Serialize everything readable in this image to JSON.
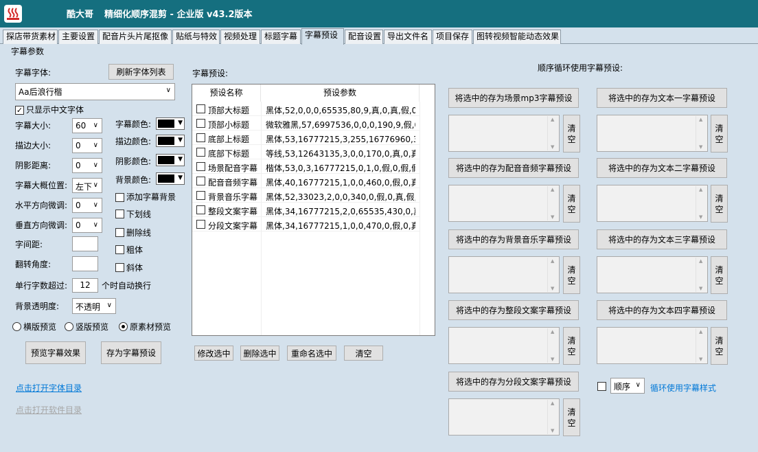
{
  "title": {
    "author": "酷大哥",
    "app": "精细化顺序混剪 - 企业版 v43.2版本"
  },
  "tabs": [
    "探店带货素材",
    "主要设置",
    "配音片头片尾抠像",
    "贴纸与特效",
    "视频处理",
    "标题字幕",
    "字幕预设",
    "配音设置",
    "导出文件名",
    "项目保存",
    "图转视频智能动态效果"
  ],
  "active_tab": "字幕预设",
  "params": {
    "section_title": "字幕参数",
    "font_label": "字幕字体:",
    "refresh_button": "刷新字体列表",
    "font_value": "Aa后浪行楷",
    "chinese_only_label": "只显示中文字体",
    "size_label": "字幕大小:",
    "size_value": "60",
    "stroke_label": "描边大小:",
    "stroke_value": "0",
    "shadow_label": "阴影距离:",
    "shadow_value": "0",
    "position_label": "字幕大概位置:",
    "position_value": "左下",
    "h_adjust_label": "水平方向微调:",
    "h_adjust_value": "0",
    "v_adjust_label": "垂直方向微调:",
    "v_adjust_value": "0",
    "spacing_label": "字间距:",
    "spacing_value": "",
    "rotate_label": "翻转角度:",
    "rotate_value": "",
    "wrap_prefix": "单行字数超过:",
    "wrap_value": "12",
    "wrap_suffix": "个时自动换行",
    "opacity_label": "背景透明度:",
    "opacity_value": "不透明",
    "font_color_label": "字幕颜色:",
    "stroke_color_label": "描边颜色:",
    "shadow_color_label": "阴影颜色:",
    "bg_color_label": "背景颜色:",
    "add_bg_label": "添加字幕背景",
    "underline_label": "下划线",
    "strikeout_label": "删除线",
    "bold_label": "粗体",
    "italic_label": "斜体",
    "preview_modes": [
      "横版预览",
      "竖版预览",
      "原素材预览"
    ],
    "preview_selected": 2,
    "preview_button": "预览字幕效果",
    "save_preset_button": "存为字幕预设",
    "open_font_dir": "点击打开字体目录",
    "open_app_dir": "点击打开软件目录"
  },
  "presets": {
    "label": "字幕预设:",
    "columns": [
      "预设名称",
      "预设参数"
    ],
    "rows": [
      {
        "name": "顶部大标题",
        "params": "黑体,52,0,0,0,65535,80,9,真,0,真,假,0,..."
      },
      {
        "name": "顶部小标题",
        "params": "微软雅黑,57,6997536,0,0,0,190,9,假,0,..."
      },
      {
        "name": "底部上标题",
        "params": "黑体,53,16777215,3,255,16776960,31..."
      },
      {
        "name": "底部下标题",
        "params": "等线,53,12643135,3,0,0,170,0,真,0,真,..."
      },
      {
        "name": "场景配音字幕",
        "params": "楷体,53,0,3,16777215,0,1,0,假,0,假,假,..."
      },
      {
        "name": "配音音频字幕",
        "params": "黑体,40,16777215,1,0,0,460,0,假,0,真,..."
      },
      {
        "name": "背景音乐字幕",
        "params": "黑体,52,33023,2,0,0,340,0,假,0,真,假,0..."
      },
      {
        "name": "整段文案字幕",
        "params": "黑体,34,16777215,2,0,65535,430,0,真,..."
      },
      {
        "name": "分段文案字幕",
        "params": "黑体,34,16777215,1,0,0,470,0,假,0,真,..."
      }
    ],
    "buttons": {
      "modify": "修改选中",
      "delete": "删除选中",
      "rename": "重命名选中",
      "clear": "清空"
    }
  },
  "cycle": {
    "title": "顺序循环使用字幕预设:",
    "left_buttons": [
      "将选中的存为场景mp3字幕预设",
      "将选中的存为配音音频字幕预设",
      "将选中的存为背景音乐字幕预设",
      "将选中的存为整段文案字幕预设",
      "将选中的存为分段文案字幕预设"
    ],
    "right_buttons": [
      "将选中的存为文本一字幕预设",
      "将选中的存为文本二字幕预设",
      "将选中的存为文本三字幕预设",
      "将选中的存为文本四字幕预设"
    ],
    "clear_label": "清空",
    "order_value": "顺序",
    "loop_link": "循环使用字幕样式"
  }
}
